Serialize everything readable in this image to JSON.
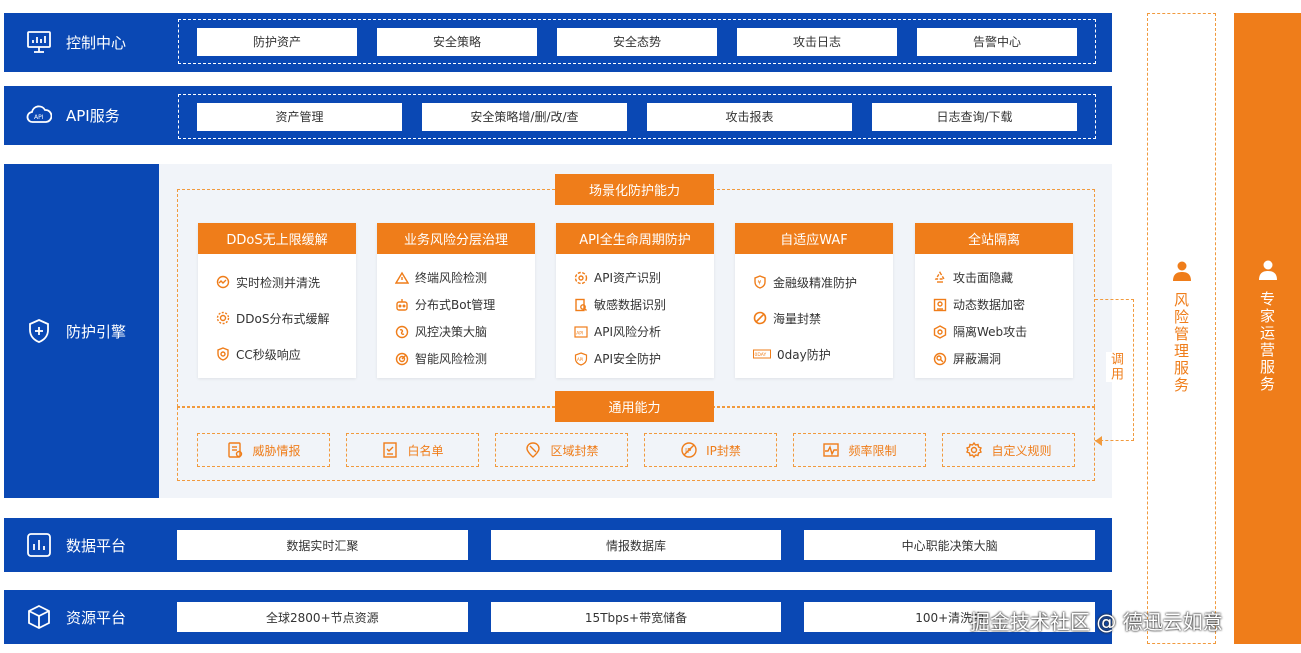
{
  "control_center": {
    "title": "控制中心",
    "items": [
      "防护资产",
      "安全策略",
      "安全态势",
      "攻击日志",
      "告警中心"
    ]
  },
  "api_service": {
    "title": "API服务",
    "items": [
      "资产管理",
      "安全策略增/删/改/查",
      "攻击报表",
      "日志查询/下载"
    ]
  },
  "protection_engine": {
    "title": "防护引擎",
    "scenario_title": "场景化防护能力",
    "cards": [
      {
        "title": "DDoS无上限缓解",
        "items": [
          "实时检测并清洗",
          "DDoS分布式缓解",
          "CC秒级响应"
        ]
      },
      {
        "title": "业务风险分层治理",
        "items": [
          "终端风险检测",
          "分布式Bot管理",
          "风控决策大脑",
          "智能风险检测"
        ]
      },
      {
        "title": "API全生命周期防护",
        "items": [
          "API资产识别",
          "敏感数据识别",
          "API风险分析",
          "API安全防护"
        ]
      },
      {
        "title": "自适应WAF",
        "items": [
          "金融级精准防护",
          "海量封禁",
          "0day防护"
        ]
      },
      {
        "title": "全站隔离",
        "items": [
          "攻击面隐藏",
          "动态数据加密",
          "隔离Web攻击",
          "屏蔽漏洞"
        ]
      }
    ],
    "general_title": "通用能力",
    "general_items": [
      "威胁情报",
      "白名单",
      "区域封禁",
      "IP封禁",
      "频率限制",
      "自定义规则"
    ],
    "call_label": "调用"
  },
  "data_platform": {
    "title": "数据平台",
    "items": [
      "数据实时汇聚",
      "情报数据库",
      "中心职能决策大脑"
    ]
  },
  "resource_platform": {
    "title": "资源平台",
    "items": [
      "全球2800+节点资源",
      "15Tbps+带宽储备",
      "100+清洗中"
    ]
  },
  "risk_management": {
    "title": "风险管理服务"
  },
  "expert_operation": {
    "title": "专家运营服务"
  },
  "watermark": "掘金技术社区 @ 德迅云如意",
  "colors": {
    "blue": "#0a48b4",
    "orange": "#ef7d1a",
    "panel": "#f1f4f9"
  }
}
